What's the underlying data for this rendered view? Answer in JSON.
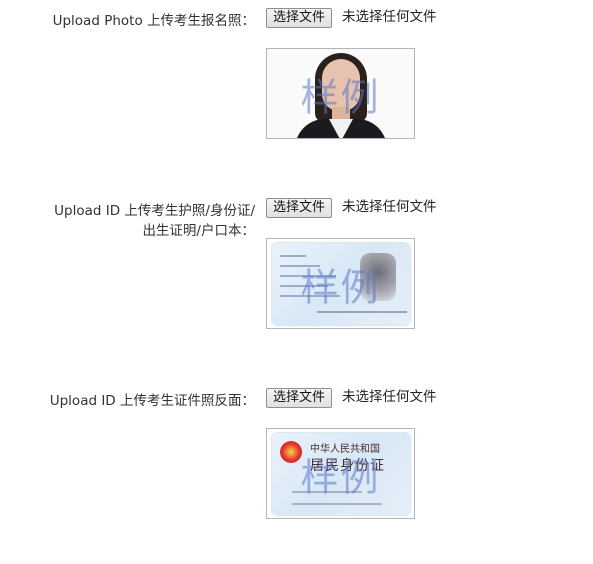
{
  "form": {
    "rows": [
      {
        "label_line1": "Upload Photo 上传考生报名照：",
        "label_line2": "",
        "button": "选择文件",
        "status": "未选择任何文件",
        "watermark": "样例"
      },
      {
        "label_line1": "Upload ID 上传考生护照/身份证/",
        "label_line2": "出生证明/户口本：",
        "button": "选择文件",
        "status": "未选择任何文件",
        "watermark": "样例"
      },
      {
        "label_line1": "Upload ID 上传考生证件照反面：",
        "label_line2": "",
        "button": "选择文件",
        "status": "未选择任何文件",
        "watermark": "样例",
        "card_title_top": "中华人民共和国",
        "card_title_main": "居民身份证"
      }
    ]
  },
  "colors": {
    "watermark": "#5a78c8",
    "button_border": "#8f8f8f"
  }
}
